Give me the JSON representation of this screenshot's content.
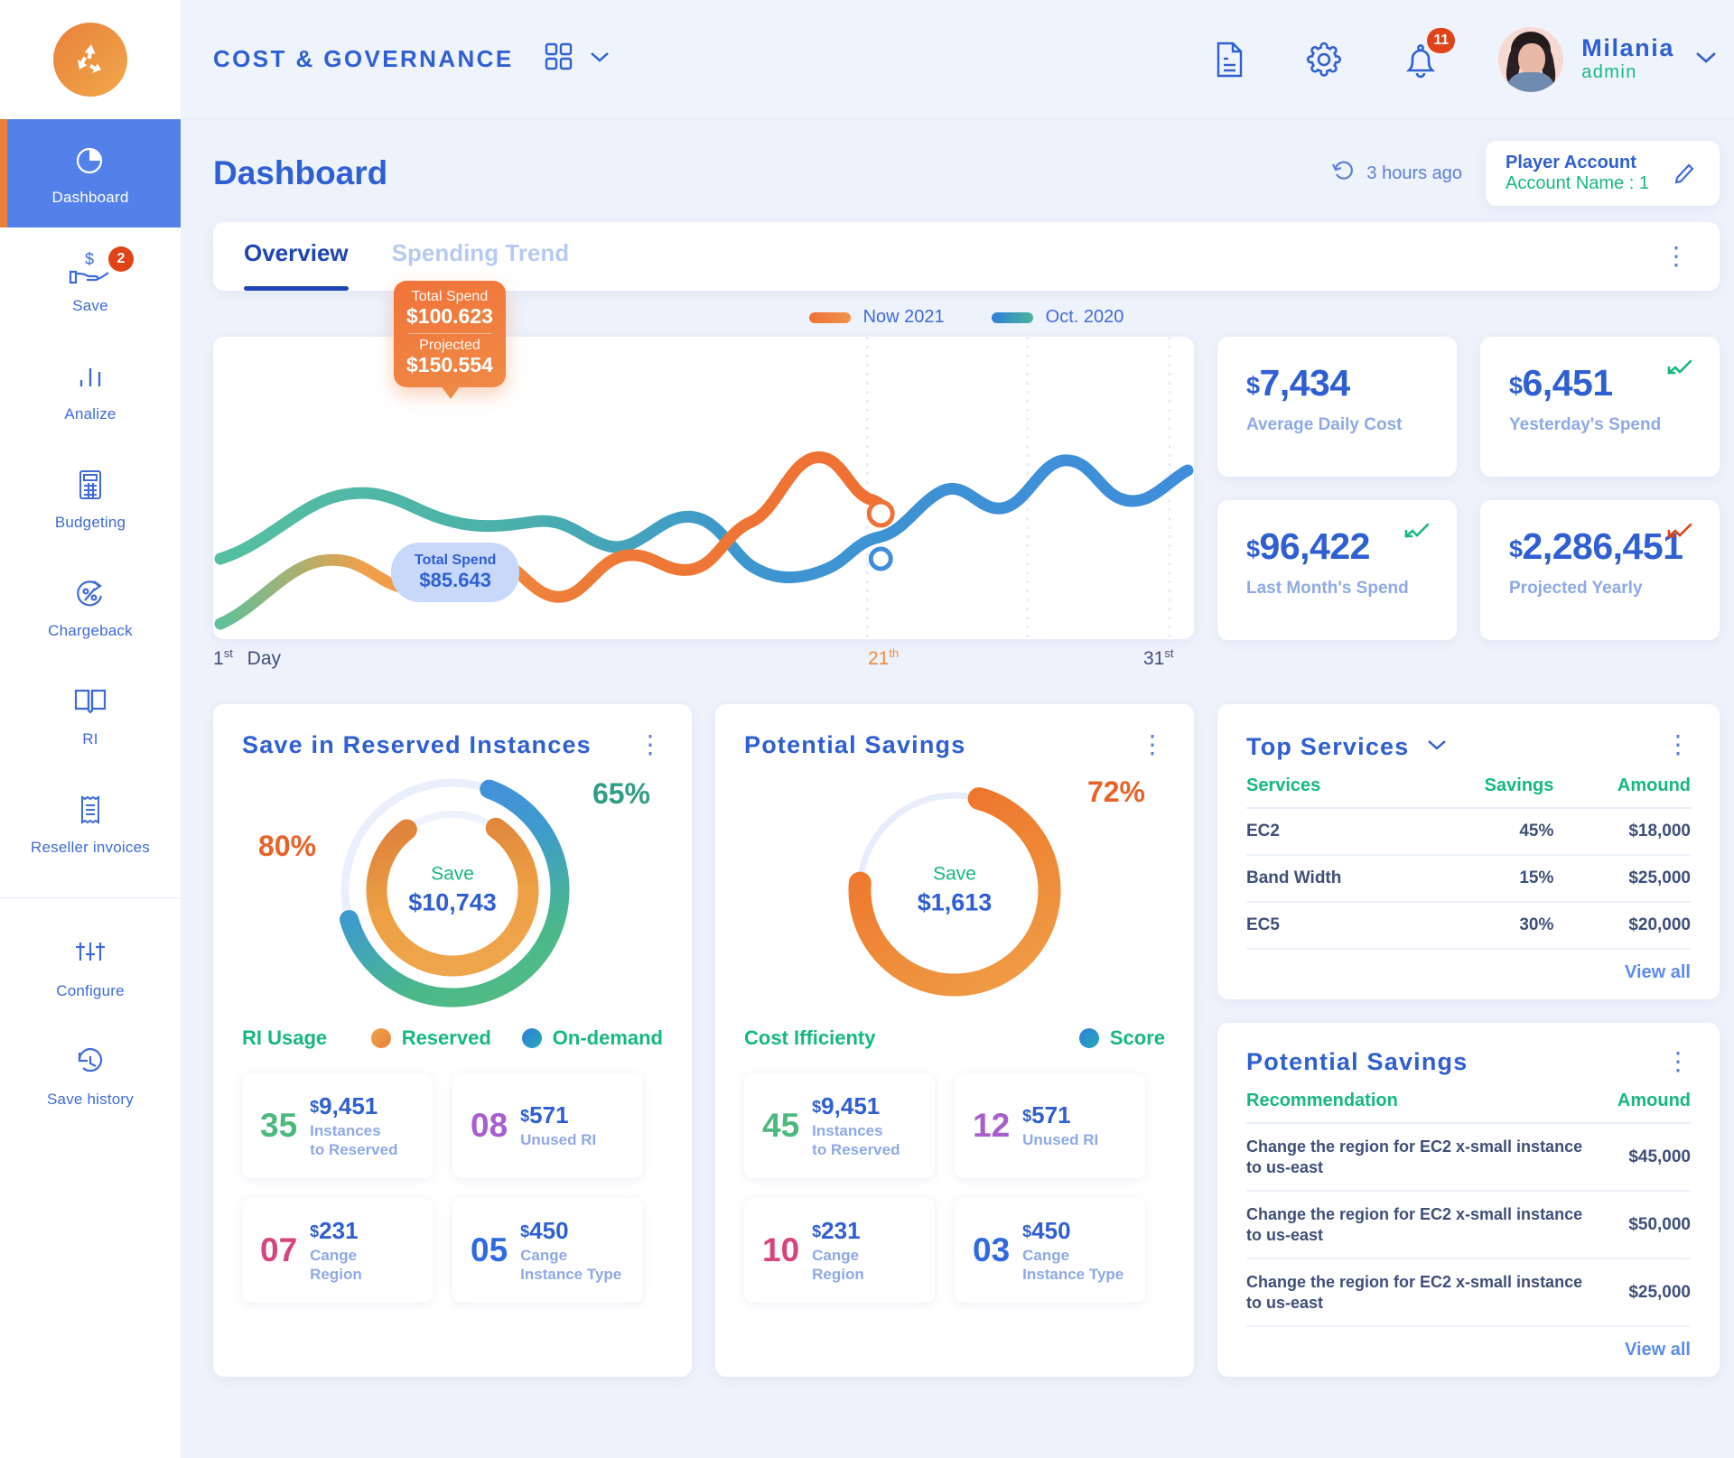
{
  "sidebar": {
    "logo_icon": "recycle-icon",
    "items": [
      {
        "label": "Dashboard",
        "icon": "pie-chart-icon",
        "active": true,
        "badge": ""
      },
      {
        "label": "Save",
        "icon": "hand-dollar-icon",
        "active": false,
        "badge": "2"
      },
      {
        "label": "Analize",
        "icon": "bar-chart-icon",
        "active": false,
        "badge": ""
      },
      {
        "label": "Budgeting",
        "icon": "calculator-icon",
        "active": false,
        "badge": ""
      },
      {
        "label": "Chargeback",
        "icon": "percent-arrow-icon",
        "active": false,
        "badge": ""
      },
      {
        "label": "RI",
        "icon": "book-icon",
        "active": false,
        "badge": ""
      },
      {
        "label": "Reseller invoices",
        "icon": "receipt-icon",
        "active": false,
        "badge": ""
      }
    ],
    "items_secondary": [
      {
        "label": "Configure",
        "icon": "sliders-icon",
        "badge": ""
      },
      {
        "label": "Save history",
        "icon": "clock-history-icon",
        "badge": ""
      }
    ]
  },
  "topbar": {
    "brand": "COST & GOVERNANCE",
    "grid_icon": "grid-apps-icon",
    "grid_chevron_icon": "chevron-down-icon",
    "icons": [
      {
        "name": "document-icon",
        "badge": ""
      },
      {
        "name": "gear-icon",
        "badge": ""
      },
      {
        "name": "bell-icon",
        "badge": "11"
      }
    ],
    "profile": {
      "name": "Milania",
      "role": "admin",
      "chevron_icon": "chevron-down-icon",
      "avatar_icon": "avatar"
    }
  },
  "page": {
    "title": "Dashboard",
    "refresh_icon": "history-rotate-icon",
    "refresh_text": "3 hours ago",
    "account": {
      "title": "Player Account",
      "subtitle": "Account Name : 1",
      "edit_icon": "pencil-icon"
    }
  },
  "tabs": [
    {
      "label": "Overview",
      "active": true
    },
    {
      "label": "Spending Trend",
      "active": false
    }
  ],
  "tabs_menu_icon": "kebab-menu-icon",
  "chart_data": {
    "type": "line",
    "title": "",
    "xlabel": "Day",
    "ylabel": "",
    "x_ticks": [
      {
        "label": "1",
        "suffix": "st",
        "extra": "Day"
      },
      {
        "label": "21",
        "suffix": "th",
        "extra": ""
      },
      {
        "label": "31",
        "suffix": "st",
        "extra": ""
      }
    ],
    "xlim": [
      1,
      31
    ],
    "grid": false,
    "legend_position": "top-center",
    "legend": [
      {
        "name": "Now 2021",
        "color": "#ef8a46"
      },
      {
        "name": "Oct. 2020",
        "color": "#3e8ed9"
      }
    ],
    "series": [
      {
        "name": "Now 2021",
        "color": "#ef8a46",
        "x": [
          1,
          3,
          5,
          7,
          9,
          11,
          13,
          15,
          17,
          19,
          21,
          23,
          25,
          27,
          29,
          31
        ],
        "values": [
          18,
          34,
          52,
          47,
          40,
          56,
          50,
          46,
          58,
          84,
          78,
          72,
          73,
          73,
          73,
          73
        ]
      },
      {
        "name": "Oct. 2020",
        "color": "#3e8ed9",
        "x": [
          1,
          3,
          5,
          7,
          9,
          11,
          13,
          15,
          17,
          19,
          21,
          23,
          25,
          27,
          29,
          31
        ],
        "values": [
          58,
          72,
          78,
          68,
          60,
          64,
          58,
          54,
          42,
          38,
          52,
          44,
          68,
          52,
          58,
          72
        ]
      }
    ],
    "annotations": [
      {
        "series": "Now 2021",
        "x": 21,
        "label": "Total Spend",
        "value": "$100.623",
        "label2": "Projected",
        "value2": "$150.554",
        "style": "orange-tooltip"
      },
      {
        "series": "Oct. 2020",
        "x": 21,
        "label": "Total Spend",
        "value": "$85.643",
        "style": "blue-tooltip"
      }
    ]
  },
  "kpis": [
    {
      "value": "7,434",
      "currency": "$",
      "label": "Average Daily Cost",
      "trend": "none",
      "trend_color": ""
    },
    {
      "value": "6,451",
      "currency": "$",
      "label": "Yesterday's Spend",
      "trend": "up",
      "trend_color": "#17b87f"
    },
    {
      "value": "96,422",
      "currency": "$",
      "label": "Last Month's Spend",
      "trend": "up",
      "trend_color": "#17b87f"
    },
    {
      "value": "2,286,451",
      "currency": "$",
      "label": "Projected Yearly",
      "trend": "down",
      "trend_color": "#df4418"
    }
  ],
  "save_reserved": {
    "title": "Save in Reserved Instances",
    "menu_icon": "kebab-menu-icon",
    "outer_pct": "65%",
    "outer_pct_color": "#2f9e84",
    "inner_pct": "80%",
    "inner_pct_color": "#e8632a",
    "center_label": "Save",
    "center_value": "$10,743",
    "legend_title": "RI Usage",
    "legend": [
      {
        "label": "Reserved",
        "color": "#ef8f3c"
      },
      {
        "label": "On-demand",
        "color": "#1f8fd0"
      }
    ],
    "tiles": [
      {
        "count": "35",
        "count_color": "#4cb97f",
        "amount": "9,451",
        "currency": "$",
        "label": "Instances\nto Reserved"
      },
      {
        "count": "08",
        "count_color": "#a75fd0",
        "amount": "571",
        "currency": "$",
        "label": "Unused RI"
      },
      {
        "count": "07",
        "count_color": "#d6457f",
        "amount": "231",
        "currency": "$",
        "label": "Cange\nRegion"
      },
      {
        "count": "05",
        "count_color": "#2f6ae0",
        "amount": "450",
        "currency": "$",
        "label": "Cange\nInstance Type"
      }
    ]
  },
  "potential_savings_chart": {
    "title": "Potential Savings",
    "menu_icon": "kebab-menu-icon",
    "pct": "72%",
    "pct_color": "#e8632a",
    "center_label": "Save",
    "center_value": "$1,613",
    "legend_title": "Cost Ifficienty",
    "legend": [
      {
        "label": "Score",
        "color": "#1f8fd0"
      }
    ],
    "tiles": [
      {
        "count": "45",
        "count_color": "#4cb97f",
        "amount": "9,451",
        "currency": "$",
        "label": "Instances\nto Reserved"
      },
      {
        "count": "12",
        "count_color": "#a75fd0",
        "amount": "571",
        "currency": "$",
        "label": "Unused RI"
      },
      {
        "count": "10",
        "count_color": "#d6457f",
        "amount": "231",
        "currency": "$",
        "label": "Cange\nRegion"
      },
      {
        "count": "03",
        "count_color": "#2f6ae0",
        "amount": "450",
        "currency": "$",
        "label": "Cange\nInstance Type"
      }
    ]
  },
  "top_services": {
    "title": "Top Services",
    "chevron_icon": "chevron-down-icon",
    "menu_icon": "kebab-menu-icon",
    "columns": [
      "Services",
      "Savings",
      "Amound"
    ],
    "rows": [
      [
        "EC2",
        "45%",
        "$18,000"
      ],
      [
        "Band Width",
        "15%",
        "$25,000"
      ],
      [
        "EC5",
        "30%",
        "$20,000"
      ]
    ],
    "view_all": "View all"
  },
  "potential_savings_table": {
    "title": "Potential Savings",
    "menu_icon": "kebab-menu-icon",
    "columns": [
      "Recommendation",
      "Amound"
    ],
    "rows": [
      [
        "Change the region for EC2 x-small instance to us-east",
        "$45,000"
      ],
      [
        "Change the region for EC2 x-small instance to us-east",
        "$50,000"
      ],
      [
        "Change the region for EC2 x-small instance to us-east",
        "$25,000"
      ]
    ],
    "view_all": "View all"
  }
}
